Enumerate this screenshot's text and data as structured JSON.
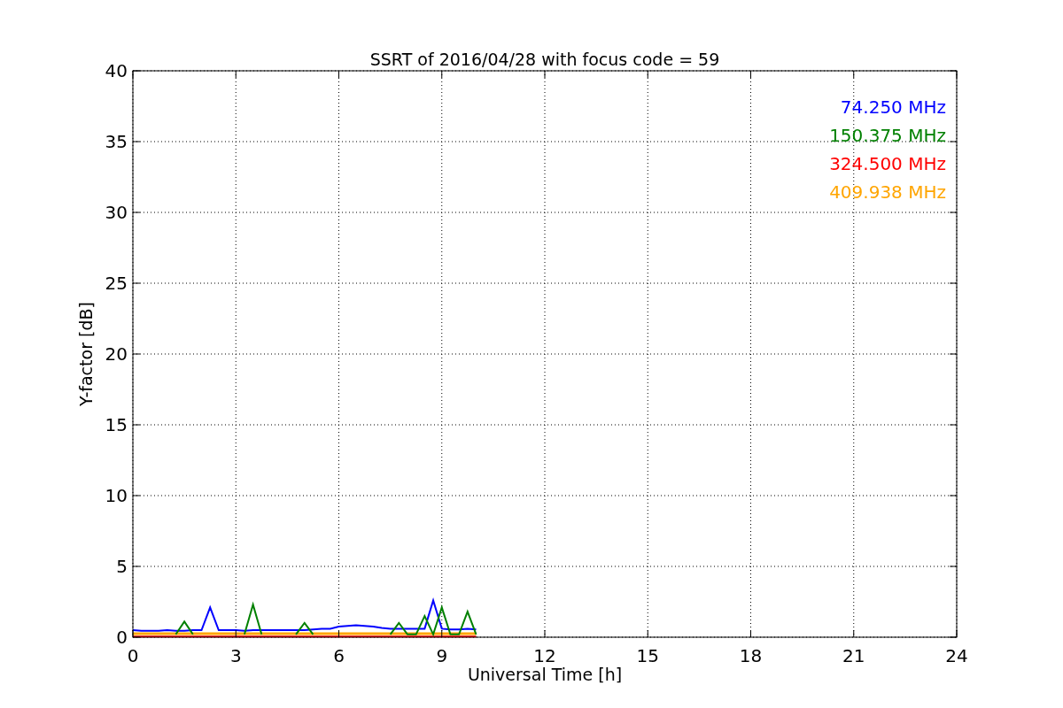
{
  "chart_data": {
    "type": "line",
    "title": "SSRT of 2016/04/28 with focus code = 59",
    "xlabel": "Universal Time [h]",
    "ylabel": "Y-factor [dB]",
    "grid": true,
    "x": [
      0,
      0.25,
      0.5,
      0.75,
      1,
      1.25,
      1.5,
      1.75,
      2,
      2.25,
      2.5,
      2.75,
      3,
      3.25,
      3.5,
      3.75,
      4,
      4.25,
      4.5,
      4.75,
      5,
      5.25,
      5.5,
      5.75,
      6,
      6.25,
      6.5,
      6.75,
      7,
      7.25,
      7.5,
      7.75,
      8,
      8.25,
      8.5,
      8.75,
      9,
      9.25,
      9.5,
      9.75,
      10
    ],
    "series": [
      {
        "name": "74.250 MHz",
        "color": "#0000ff",
        "values": [
          0.5,
          0.45,
          0.45,
          0.45,
          0.5,
          0.45,
          0.45,
          0.5,
          0.5,
          2.1,
          0.5,
          0.5,
          0.5,
          0.45,
          0.5,
          0.5,
          0.5,
          0.5,
          0.5,
          0.5,
          0.5,
          0.55,
          0.6,
          0.6,
          0.75,
          0.8,
          0.85,
          0.8,
          0.75,
          0.65,
          0.6,
          0.6,
          0.6,
          0.6,
          0.6,
          2.6,
          0.6,
          0.55,
          0.55,
          0.6,
          0.55
        ]
      },
      {
        "name": "150.375 MHz",
        "color": "#008000",
        "values": [
          null,
          null,
          null,
          null,
          null,
          0.2,
          1.1,
          0.2,
          null,
          null,
          null,
          null,
          null,
          0.2,
          2.3,
          0.2,
          null,
          null,
          null,
          0.2,
          1.0,
          0.2,
          null,
          null,
          null,
          null,
          null,
          null,
          null,
          null,
          0.2,
          1.0,
          0.2,
          0.2,
          1.5,
          0.2,
          2.1,
          0.2,
          0.2,
          1.8,
          0.2
        ]
      },
      {
        "name": "324.500 MHz",
        "color": "#ff0000",
        "values": [
          0.05,
          0.05,
          0.05,
          0.05,
          0.05,
          0.05,
          0.05,
          0.05,
          0.05,
          0.05,
          0.05,
          0.05,
          0.05,
          0.05,
          0.05,
          0.05,
          0.05,
          0.05,
          0.05,
          0.05,
          0.05,
          0.05,
          0.05,
          0.05,
          0.05,
          0.05,
          0.05,
          0.05,
          0.05,
          0.05,
          0.05,
          0.05,
          0.05,
          0.05,
          0.05,
          0.05,
          0.05,
          0.05,
          0.05,
          0.05,
          0.05
        ]
      },
      {
        "name": "409.938 MHz",
        "color": "#ffa500",
        "values": [
          0.25,
          0.25,
          0.25,
          0.25,
          0.25,
          0.25,
          0.25,
          0.25,
          0.25,
          0.25,
          0.25,
          0.25,
          0.25,
          0.25,
          0.25,
          0.25,
          0.25,
          0.25,
          0.25,
          0.25,
          0.25,
          0.25,
          0.25,
          0.25,
          0.25,
          0.25,
          0.25,
          0.25,
          0.25,
          0.25,
          0.25,
          0.25,
          0.25,
          0.25,
          0.25,
          0.25,
          0.25,
          0.25,
          0.25,
          0.25,
          0.25
        ]
      }
    ],
    "xlim": [
      0,
      24
    ],
    "ylim": [
      0,
      40
    ],
    "xticks": [
      0,
      3,
      6,
      9,
      12,
      15,
      18,
      21,
      24
    ],
    "yticks": [
      0,
      5,
      10,
      15,
      20,
      25,
      30,
      35,
      40
    ]
  }
}
